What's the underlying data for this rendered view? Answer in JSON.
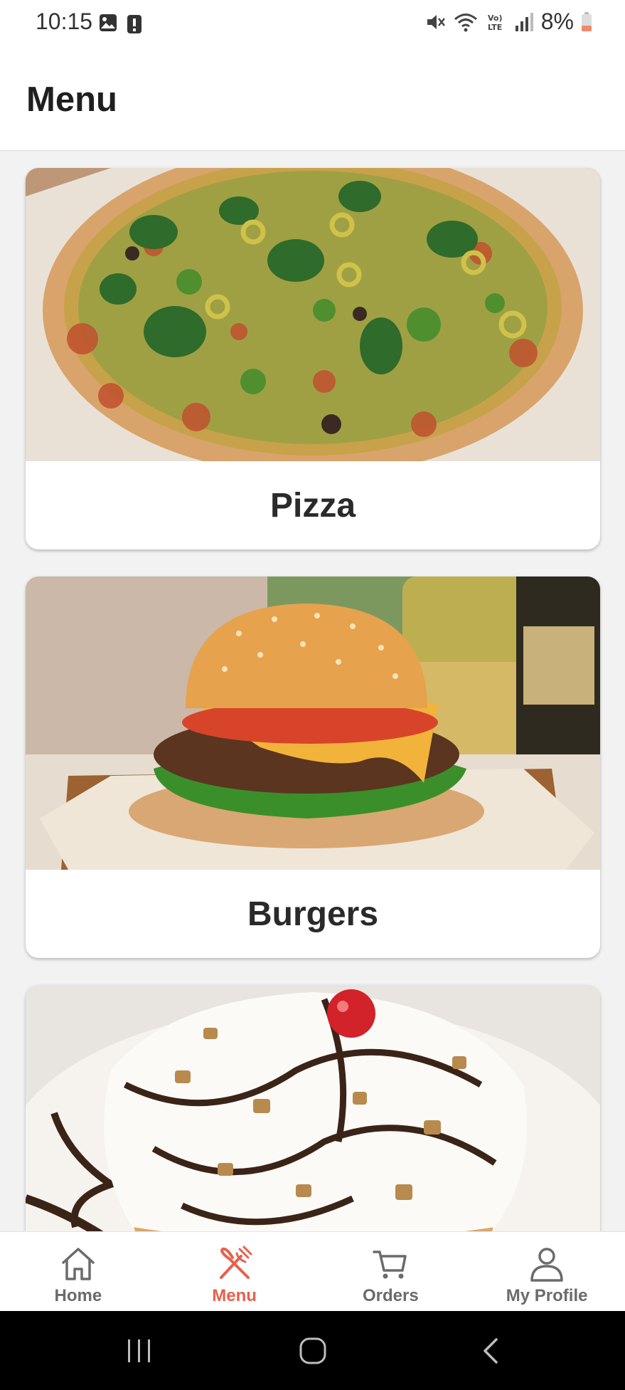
{
  "status_bar": {
    "time": "10:15",
    "battery": "8%",
    "icons": [
      "image-icon",
      "notification-icon",
      "mute-icon",
      "wifi-icon",
      "volte-icon",
      "signal-icon",
      "battery-low-icon"
    ]
  },
  "header": {
    "title": "Menu"
  },
  "categories": [
    {
      "label": "Pizza",
      "image": "pizza-photo"
    },
    {
      "label": "Burgers",
      "image": "burger-photo"
    },
    {
      "label": "",
      "image": "sundae-photo"
    }
  ],
  "bottom_nav": {
    "active": "Menu",
    "active_color": "#e8604c",
    "items": [
      {
        "label": "Home",
        "icon": "home-icon"
      },
      {
        "label": "Menu",
        "icon": "utensils-icon"
      },
      {
        "label": "Orders",
        "icon": "cart-icon"
      },
      {
        "label": "My Profile",
        "icon": "person-icon"
      }
    ]
  },
  "system_nav": {
    "buttons": [
      "recent-apps-icon",
      "home-circle-icon",
      "back-icon"
    ]
  }
}
